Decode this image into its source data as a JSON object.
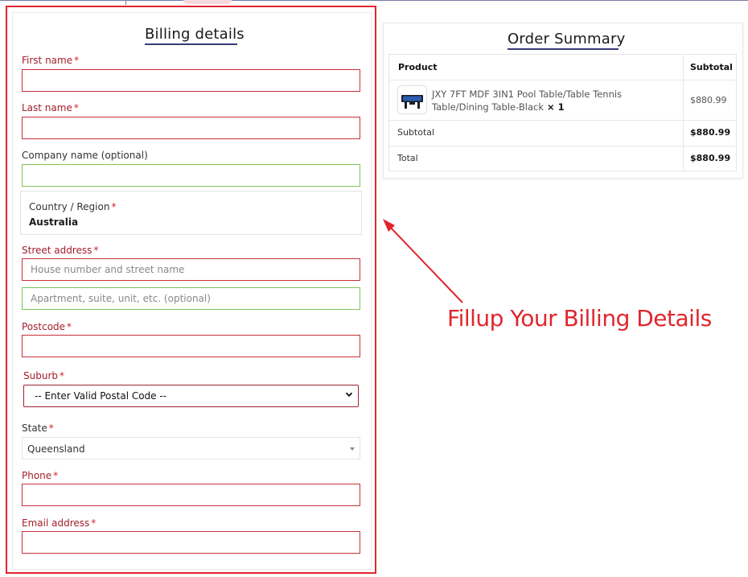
{
  "billing": {
    "title": "Billing details",
    "fields": {
      "first_name": {
        "label": "First name",
        "required": "*"
      },
      "last_name": {
        "label": "Last name",
        "required": "*"
      },
      "company": {
        "label": "Company name (optional)"
      },
      "country": {
        "label": "Country / Region",
        "required": "*",
        "value": "Australia"
      },
      "street": {
        "label": "Street address",
        "required": "*",
        "placeholder_1": "House number and street name",
        "placeholder_2": "Apartment, suite, unit, etc. (optional)"
      },
      "postcode": {
        "label": "Postcode",
        "required": "*"
      },
      "suburb": {
        "label": "Suburb",
        "required": "*",
        "value": "-- Enter Valid Postal Code --"
      },
      "state": {
        "label": "State",
        "required": "*",
        "value": "Queensland"
      },
      "phone": {
        "label": "Phone",
        "required": "*"
      },
      "email": {
        "label": "Email address",
        "required": "*"
      }
    }
  },
  "order": {
    "title": "Order Summary",
    "headers": {
      "product": "Product",
      "subtotal": "Subtotal"
    },
    "item": {
      "name": "JXY 7FT MDF 3IN1 Pool Table/Table Tennis Table/Dining Table-Black",
      "quantity": "× 1",
      "price": "$880.99"
    },
    "subtotal": {
      "label": "Subtotal",
      "value": "$880.99"
    },
    "total": {
      "label": "Total",
      "value": "$880.99"
    }
  },
  "annotation": {
    "text": "Fillup Your Billing Details"
  },
  "colors": {
    "annotation_red": "#e0262d",
    "invalid_border": "#c8303a",
    "valid_border": "#7dc456",
    "title_underline": "#3b3b78"
  }
}
